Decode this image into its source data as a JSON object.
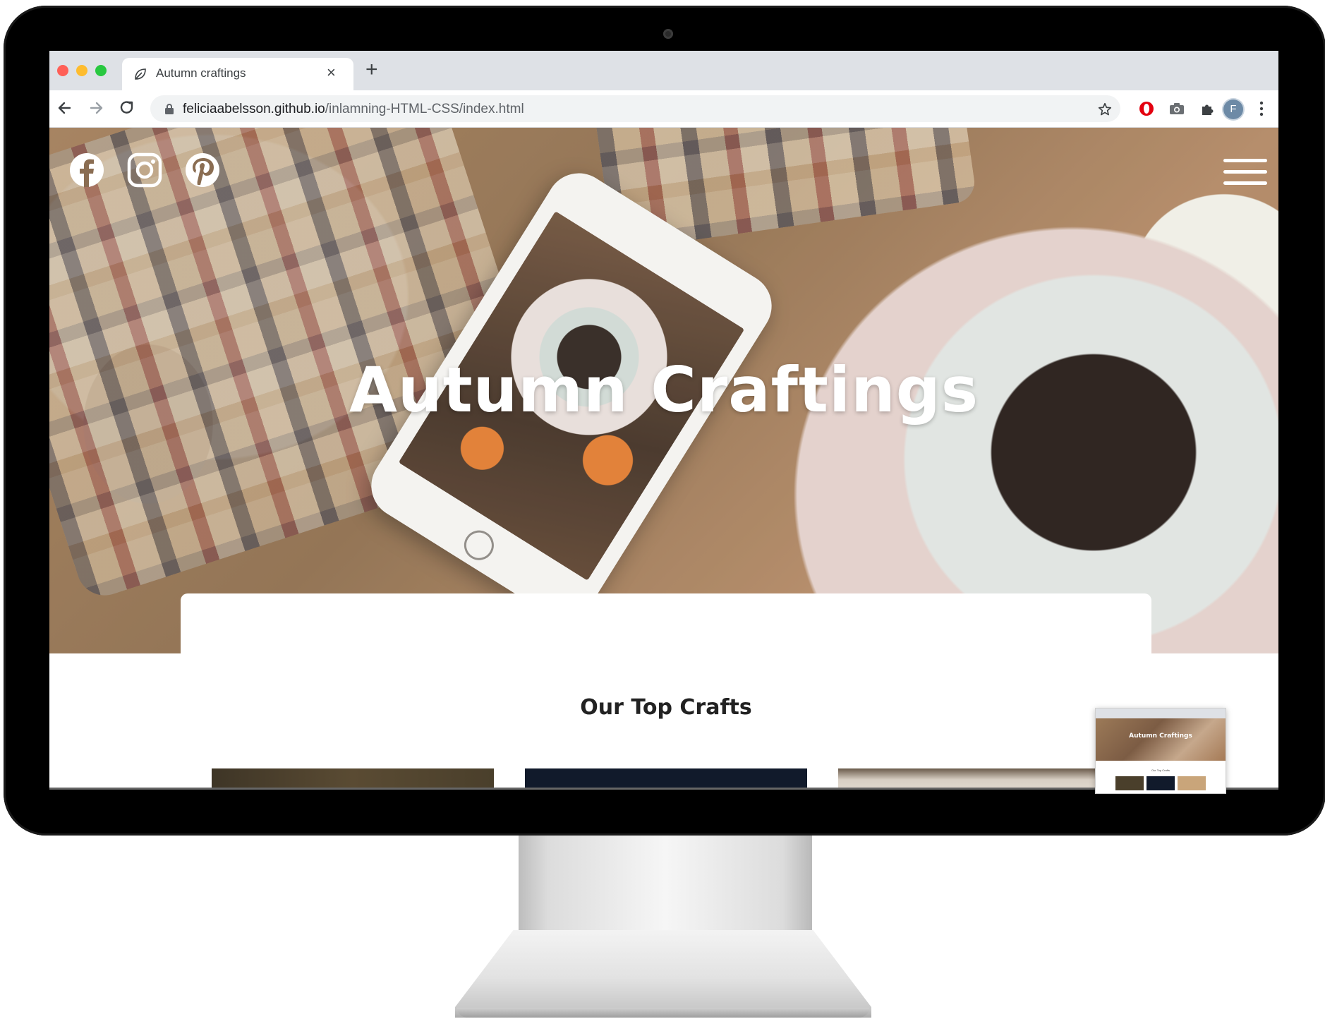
{
  "browser": {
    "tab_title": "Autumn craftings",
    "new_tab_symbol": "+",
    "close_tab_symbol": "×",
    "url_host": "feliciaabelsson.github.io",
    "url_path": "/inlamning-HTML-CSS/index.html",
    "profile_initial": "F",
    "icons": [
      "back-arrow-icon",
      "forward-arrow-icon",
      "reload-icon",
      "lock-icon",
      "star-icon",
      "opera-extension-icon",
      "camera-extension-icon",
      "puzzle-extension-icon",
      "more-menu-icon"
    ]
  },
  "hero": {
    "title": "Autumn Craftings",
    "social_icons": [
      "facebook-icon",
      "instagram-icon",
      "pinterest-icon"
    ],
    "menu_icon": "hamburger-menu-icon"
  },
  "content": {
    "section_title": "Our Top Crafts"
  },
  "mini_preview": {
    "title": "Autumn Craftings",
    "section_title": "Our Top Crafts"
  },
  "colors": {
    "tab_bar": "#dee1e6",
    "monitor_bezel": "#000000",
    "hero_text": "#ffffff",
    "section_title": "#222222"
  }
}
